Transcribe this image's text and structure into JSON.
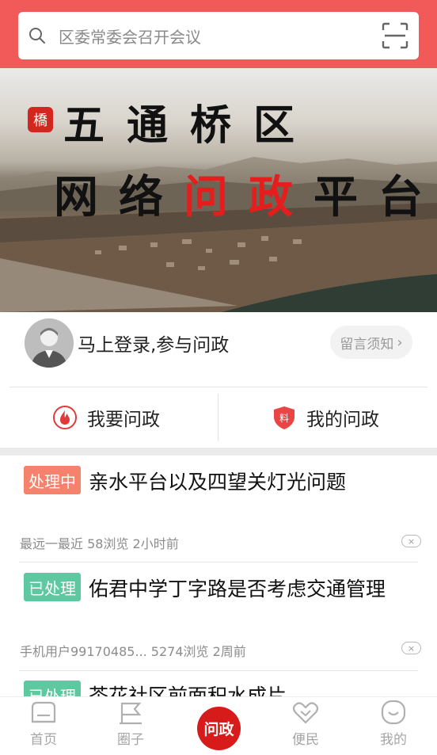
{
  "search": {
    "placeholder": "区委常委会召开会议",
    "icon": "search-icon",
    "scan_icon": "scan-icon"
  },
  "banner": {
    "badge": "橋",
    "title_line1": "五通桥区",
    "title_line2_a": "网络",
    "title_line2_b": "问政",
    "title_line2_c": "平台"
  },
  "login": {
    "prompt": "马上登录,参与问政",
    "notice_button": "留言须知",
    "notice_chevron": "›"
  },
  "actions": {
    "ask": "我要问政",
    "mine": "我的问政"
  },
  "news": [
    {
      "status": "处理中",
      "title": "亲水平台以及四望关灯光问题",
      "meta": "最远一最近 58浏览 2小时前",
      "close": "×"
    },
    {
      "status": "已处理",
      "title": "佑君中学丁字路是否考虑交通管理",
      "meta": "手机用户99170485... 5274浏览 2周前",
      "close": "×"
    },
    {
      "status": "已处理",
      "title": "茶花社区前面积水成片"
    }
  ],
  "tabbar": {
    "home": "首页",
    "circle": "圈子",
    "center": "问政",
    "service": "便民",
    "me": "我的"
  },
  "colors": {
    "brand_red": "#f25a5a",
    "processing": "#f5826d",
    "done": "#5ec9a0"
  }
}
